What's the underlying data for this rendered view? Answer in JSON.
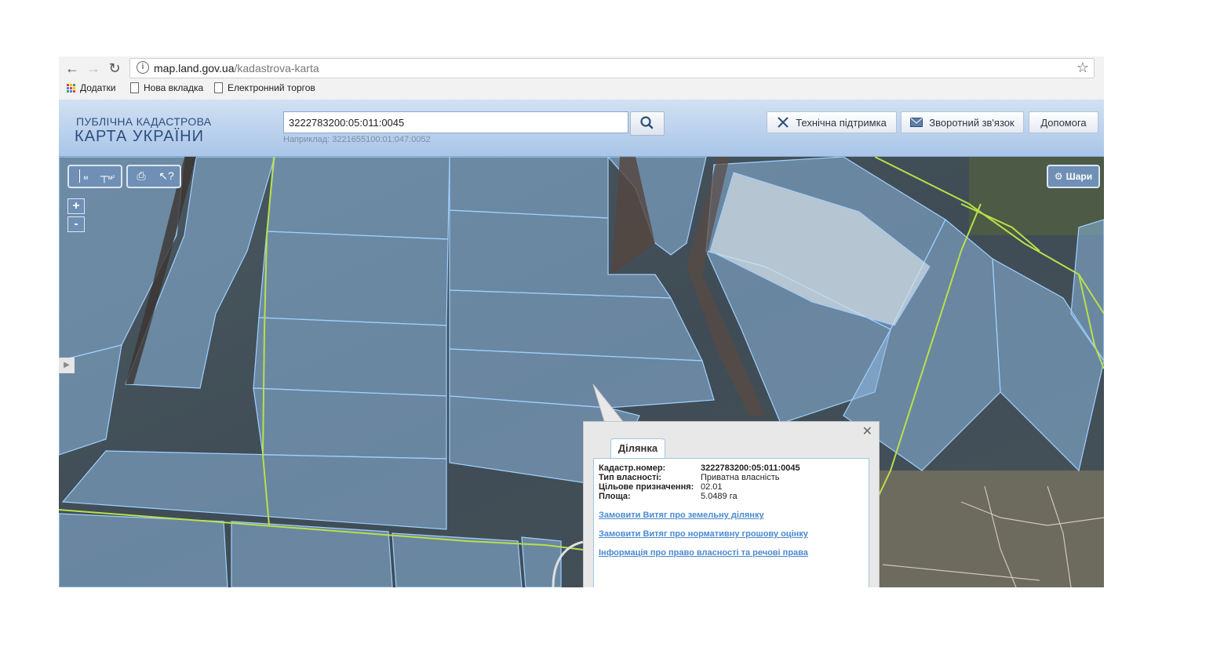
{
  "browser": {
    "url_host": "map.land.gov.ua",
    "url_path": "/kadastrova-karta",
    "bookmarks": [
      "Додатки",
      "Нова вкладка",
      "Електронний торгов"
    ]
  },
  "header": {
    "logo_line1": "ПУБЛІЧНА КАДАСТРОВА",
    "logo_line2": "КАРТА УКРАЇНИ",
    "search_value": "3222783200:05:011:0045",
    "search_hint": "Наприклад: 3221655100:01:047:0052",
    "buttons": {
      "support": "Технічна підтримка",
      "feedback": "Зворотний зв'язок",
      "help": "Допомога"
    }
  },
  "map": {
    "tools": {
      "measure_m": "м",
      "measure_area": "м²"
    },
    "zoom_in": "+",
    "zoom_out": "-",
    "layers_label": "Шари"
  },
  "popup": {
    "tab": "Ділянка",
    "fields": [
      {
        "key": "Кадастр.номер:",
        "value": "3222783200:05:011:0045"
      },
      {
        "key": "Тип власності:",
        "value": "Приватна власність"
      },
      {
        "key": "Цільове призначення:",
        "value": "02.01"
      },
      {
        "key": "Площа:",
        "value": "5.0489 га"
      }
    ],
    "links": [
      "Замовити Витяг про земельну ділянку",
      "Замовити Витяг про нормативну грошову оцінку",
      "Інформація про право власності та речові права"
    ]
  },
  "colors": {
    "parcel_fill": "#8cb6df",
    "parcel_border": "#9fd0ff",
    "boundary_line": "#b8e04a",
    "header_bg": "#b9d0ee"
  }
}
